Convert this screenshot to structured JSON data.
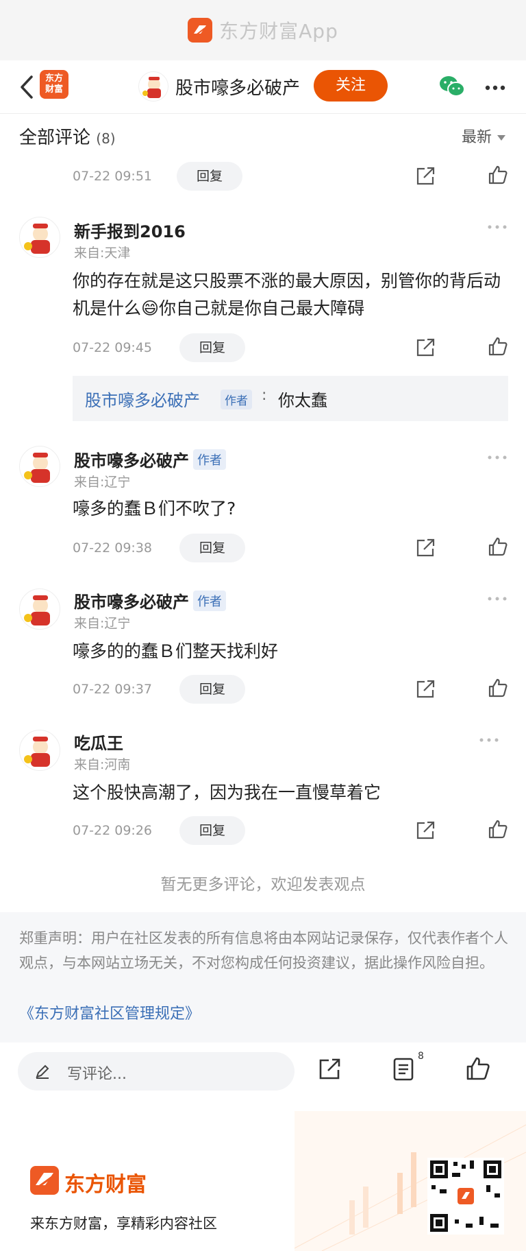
{
  "app_banner": {
    "title": "东方财富App"
  },
  "header": {
    "site_logo_text": "东方\n财富",
    "name": "股市嚎多必破产",
    "follow_label": "关注"
  },
  "comments_header": {
    "title": "全部评论",
    "count": "(8)",
    "sort_label": "最新"
  },
  "reply_label": "回复",
  "author_badge": "作者",
  "comments": [
    {
      "time": "07-22 09:51"
    },
    {
      "name": "新手报到2016",
      "location": "来自:天津",
      "text": "你的存在就是这只股票不涨的最大原因，别管你的背后动机是什么😄你自己就是你自己最大障碍",
      "time": "07-22 09:45"
    },
    {
      "name": "股市嚎多必破产",
      "location": "来自:辽宁",
      "text": "嚎多的蠢Ｂ们不吹了?",
      "time": "07-22 09:38"
    },
    {
      "name": "股市嚎多必破产",
      "location": "来自:辽宁",
      "text": "嚎多的的蠢Ｂ们整天找利好",
      "time": "07-22 09:37"
    },
    {
      "name": "吃瓜王",
      "location": "来自:河南",
      "text": "这个股快高潮了，因为我在一直慢草着它",
      "time": "07-22 09:26"
    }
  ],
  "reply_box": {
    "name": "股市嚎多必破产",
    "badge": "作者",
    "sep": ":",
    "text": "你太蠢"
  },
  "no_more": "暂无更多评论，欢迎发表观点",
  "disclaimer": {
    "text": "郑重声明：用户在社区发表的所有信息将由本网站记录保存，仅代表作者个人观点，与本网站立场无关，不对您构成任何投资建议，据此操作风险自担。",
    "link": "《东方财富社区管理规定》"
  },
  "bottom_bar": {
    "placeholder": "写评论...",
    "comment_count": "8"
  },
  "footer": {
    "brand": "东方财富",
    "slogan": "来东方财富，享精彩内容社区"
  },
  "colors": {
    "brand_orange": "#ea5504",
    "link_blue": "#3b6fb6"
  }
}
